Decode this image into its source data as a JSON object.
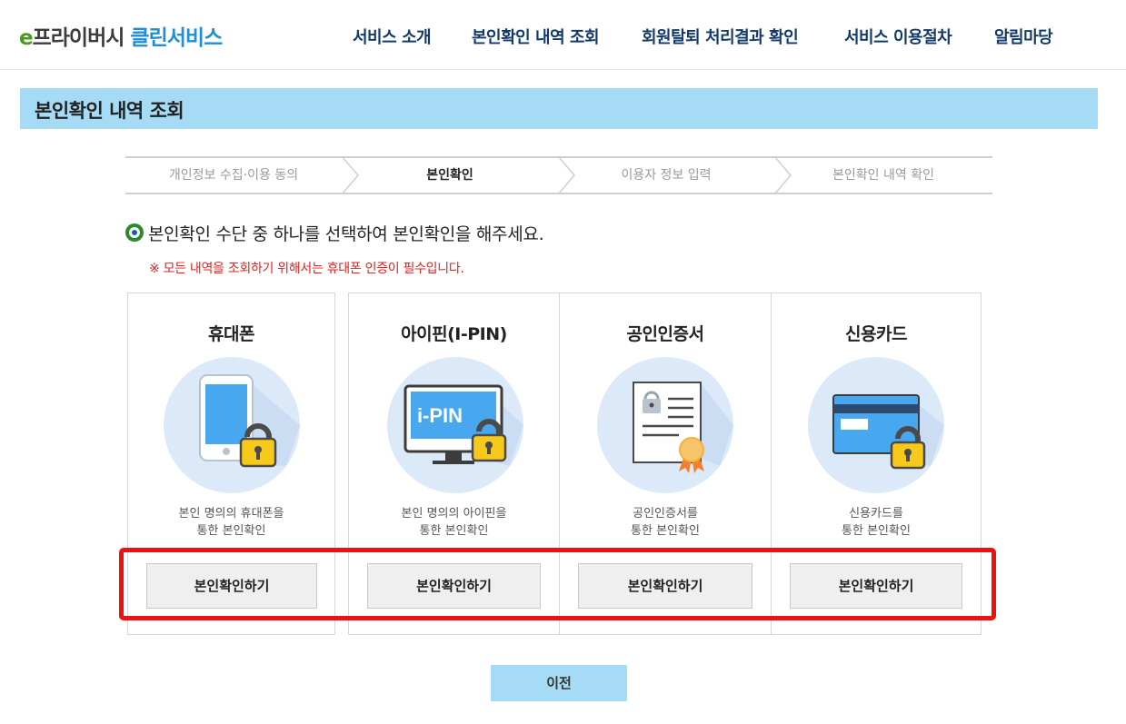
{
  "logo": {
    "prefix": "e",
    "part1": "프라이버시",
    "part2": " 클린서비스"
  },
  "nav": [
    {
      "label": "서비스 소개"
    },
    {
      "label": "본인확인 내역 조회"
    },
    {
      "label": "회원탈퇴 처리결과 확인"
    },
    {
      "label": "서비스 이용절차"
    },
    {
      "label": "알림마당"
    }
  ],
  "page_title": "본인확인 내역 조회",
  "steps": [
    {
      "label": "개인정보 수집·이용 동의",
      "active": false
    },
    {
      "label": "본인확인",
      "active": true
    },
    {
      "label": "이용자 정보 입력",
      "active": false
    },
    {
      "label": "본인확인 내역 확인",
      "active": false
    }
  ],
  "instruction": "본인확인 수단 중 하나를 선택하여 본인확인을 해주세요.",
  "notice": "※ 모든 내역을 조회하기 위해서는 휴대폰 인증이 필수입니다.",
  "methods": [
    {
      "title": "휴대폰",
      "desc_line1": "본인 명의의 휴대폰을",
      "desc_line2": "통한 본인확인",
      "button": "본인확인하기",
      "icon": "mobile-phone-lock-icon"
    },
    {
      "title": "아이핀(I-PIN)",
      "icon_text": "i-PIN",
      "desc_line1": "본인 명의의 아이핀을",
      "desc_line2": "통한 본인확인",
      "button": "본인확인하기",
      "icon": "ipin-monitor-lock-icon"
    },
    {
      "title": "공인인증서",
      "desc_line1": "공인인증서를",
      "desc_line2": "통한 본인확인",
      "button": "본인확인하기",
      "icon": "certificate-icon"
    },
    {
      "title": "신용카드",
      "desc_line1": "신용카드를",
      "desc_line2": "통한 본인확인",
      "button": "본인확인하기",
      "icon": "credit-card-lock-icon"
    }
  ],
  "prev_button": "이전",
  "colors": {
    "title_bar": "#a6dbf5",
    "nav_text": "#133a6b",
    "notice_red": "#e32020",
    "highlight_red": "#ee1111",
    "icon_circle": "#dce9f8",
    "lock_yellow": "#f7c91a"
  }
}
